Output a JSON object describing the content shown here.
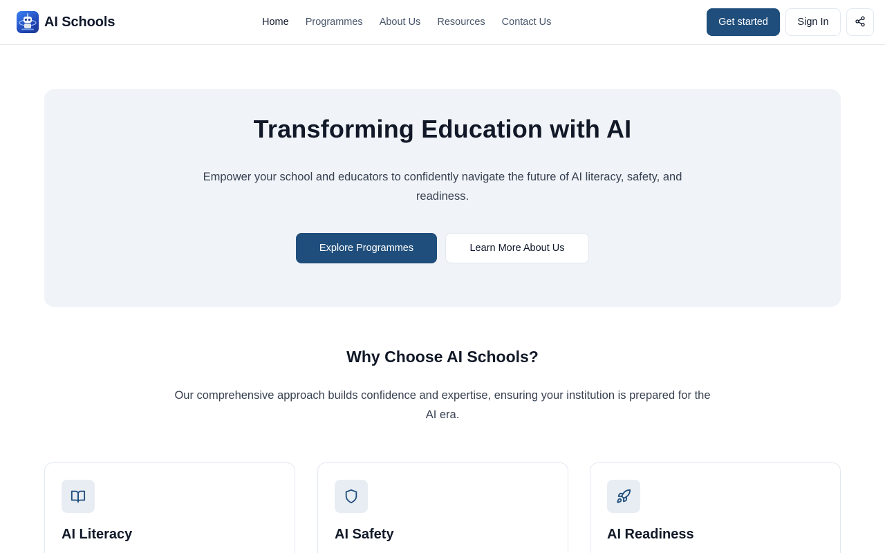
{
  "brand": {
    "name": "AI Schools",
    "logo_icon": "robot-logo-icon",
    "accent_color": "#1f4e7c"
  },
  "nav": {
    "items": [
      {
        "label": "Home",
        "active": true
      },
      {
        "label": "Programmes",
        "active": false
      },
      {
        "label": "About Us",
        "active": false
      },
      {
        "label": "Resources",
        "active": false
      },
      {
        "label": "Contact Us",
        "active": false
      }
    ]
  },
  "header_actions": {
    "get_started": "Get started",
    "sign_in": "Sign In",
    "share_icon": "share-icon"
  },
  "hero": {
    "title": "Transforming Education with AI",
    "subtitle": "Empower your school and educators to confidently navigate the future of AI literacy, safety, and readiness.",
    "primary_cta": "Explore Programmes",
    "secondary_cta": "Learn More About Us"
  },
  "why": {
    "title": "Why Choose AI Schools?",
    "subtitle": "Our comprehensive approach builds confidence and expertise, ensuring your institution is prepared for the AI era."
  },
  "features": [
    {
      "title": "AI Literacy",
      "icon": "book-open-icon"
    },
    {
      "title": "AI Safety",
      "icon": "shield-icon"
    },
    {
      "title": "AI Readiness",
      "icon": "rocket-icon"
    }
  ]
}
